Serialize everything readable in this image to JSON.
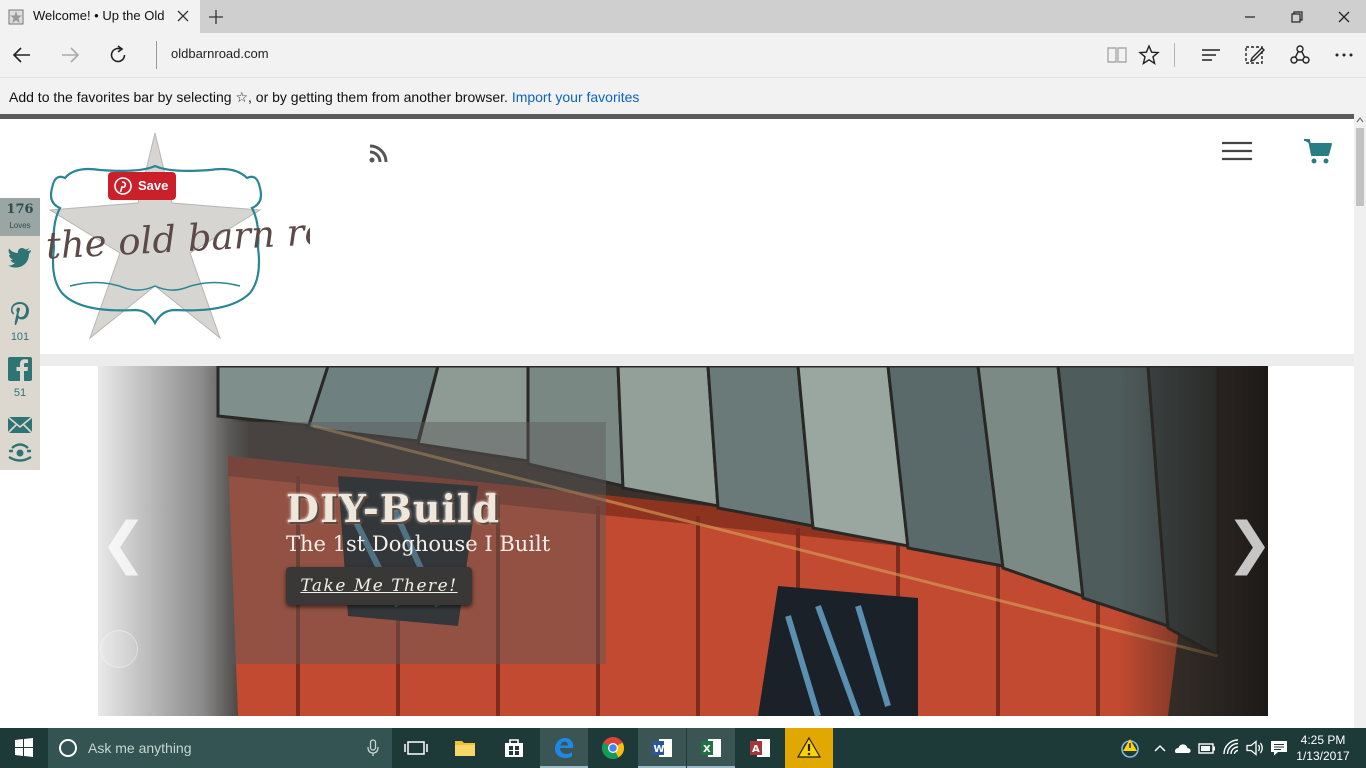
{
  "browser": {
    "tab_title": "Welcome! • Up the Old",
    "address": "oldbarnroad.com",
    "favorites_bar": {
      "message": "Add to the favorites bar by selecting ☆, or by getting them from another browser. ",
      "link": "Import your favorites"
    }
  },
  "page": {
    "logo_text": "the old barn road",
    "pinterest_save_label": "Save",
    "share": {
      "loves_count": "176",
      "loves_label": "Loves",
      "pinterest_count": "101",
      "facebook_count": "51"
    },
    "slider": {
      "title": "DIY-Build",
      "subtitle": "The 1st Doghouse I Built",
      "button": "Take Me There!",
      "prev_arrow": "❮",
      "next_arrow": "❯"
    }
  },
  "taskbar": {
    "search_placeholder": "Ask me anything",
    "time": "4:25 PM",
    "date": "1/13/2017"
  },
  "colors": {
    "accent_teal": "#2a7d84",
    "pinterest_red": "#cb1f2a",
    "taskbar": "#1e3a38"
  }
}
